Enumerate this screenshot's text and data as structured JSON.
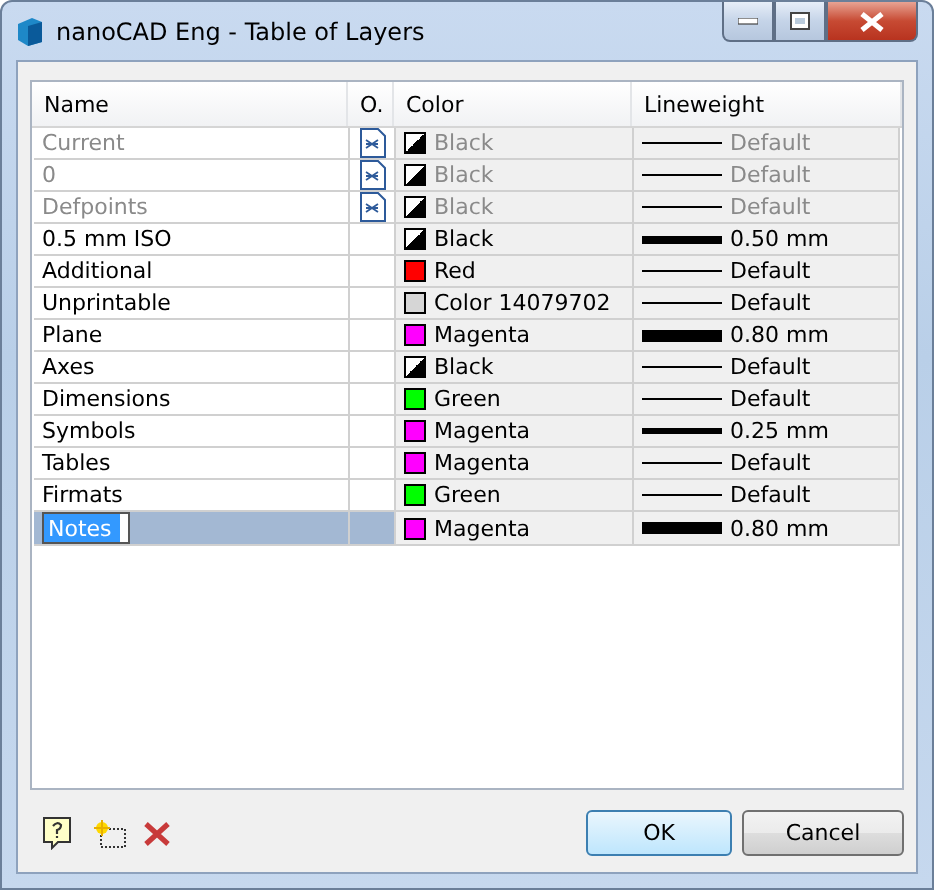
{
  "window": {
    "title": "nanoCAD Eng - Table of Layers"
  },
  "table": {
    "columns": [
      "Name",
      "O.",
      "Color",
      "Lineweight"
    ],
    "rows": [
      {
        "name": "Current",
        "dimmed": true,
        "owner_icon": true,
        "swatch": {
          "kind": "diagonal",
          "color": "#000000",
          "label": "Black"
        },
        "lineweight": {
          "kind": "thin",
          "label": "Default"
        },
        "selected": false,
        "editing": false
      },
      {
        "name": "0",
        "dimmed": true,
        "owner_icon": true,
        "swatch": {
          "kind": "diagonal",
          "color": "#000000",
          "label": "Black"
        },
        "lineweight": {
          "kind": "thin",
          "label": "Default"
        },
        "selected": false,
        "editing": false
      },
      {
        "name": "Defpoints",
        "dimmed": true,
        "owner_icon": true,
        "swatch": {
          "kind": "diagonal",
          "color": "#000000",
          "label": "Black"
        },
        "lineweight": {
          "kind": "thin",
          "label": "Default"
        },
        "selected": false,
        "editing": false
      },
      {
        "name": "0.5 mm ISO",
        "dimmed": false,
        "owner_icon": false,
        "swatch": {
          "kind": "diagonal",
          "color": "#000000",
          "label": "Black"
        },
        "lineweight": {
          "kind": "thick",
          "label": "0.50 mm"
        },
        "selected": false,
        "editing": false
      },
      {
        "name": "Additional",
        "dimmed": false,
        "owner_icon": false,
        "swatch": {
          "kind": "solid",
          "color": "#ff0000",
          "label": "Red"
        },
        "lineweight": {
          "kind": "thin",
          "label": "Default"
        },
        "selected": false,
        "editing": false
      },
      {
        "name": "Unprintable",
        "dimmed": false,
        "owner_icon": false,
        "swatch": {
          "kind": "solid",
          "color": "#d6d6d6",
          "label": "Color 14079702"
        },
        "lineweight": {
          "kind": "thin",
          "label": "Default"
        },
        "selected": false,
        "editing": false
      },
      {
        "name": "Plane",
        "dimmed": false,
        "owner_icon": false,
        "swatch": {
          "kind": "solid",
          "color": "#ff00ff",
          "label": "Magenta"
        },
        "lineweight": {
          "kind": "heavy",
          "label": "0.80 mm"
        },
        "selected": false,
        "editing": false
      },
      {
        "name": "Axes",
        "dimmed": false,
        "owner_icon": false,
        "swatch": {
          "kind": "diagonal",
          "color": "#000000",
          "label": "Black"
        },
        "lineweight": {
          "kind": "thin",
          "label": "Default"
        },
        "selected": false,
        "editing": false
      },
      {
        "name": "Dimensions",
        "dimmed": false,
        "owner_icon": false,
        "swatch": {
          "kind": "solid",
          "color": "#00ff00",
          "label": "Green"
        },
        "lineweight": {
          "kind": "thin",
          "label": "Default"
        },
        "selected": false,
        "editing": false
      },
      {
        "name": "Symbols",
        "dimmed": false,
        "owner_icon": false,
        "swatch": {
          "kind": "solid",
          "color": "#ff00ff",
          "label": "Magenta"
        },
        "lineweight": {
          "kind": "medium",
          "label": "0.25 mm"
        },
        "selected": false,
        "editing": false
      },
      {
        "name": "Tables",
        "dimmed": false,
        "owner_icon": false,
        "swatch": {
          "kind": "solid",
          "color": "#ff00ff",
          "label": "Magenta"
        },
        "lineweight": {
          "kind": "thin",
          "label": "Default"
        },
        "selected": false,
        "editing": false
      },
      {
        "name": "Firmats",
        "dimmed": false,
        "owner_icon": false,
        "swatch": {
          "kind": "solid",
          "color": "#00ff00",
          "label": "Green"
        },
        "lineweight": {
          "kind": "thin",
          "label": "Default"
        },
        "selected": false,
        "editing": false
      },
      {
        "name": "Notes",
        "dimmed": false,
        "owner_icon": false,
        "swatch": {
          "kind": "solid",
          "color": "#ff00ff",
          "label": "Magenta"
        },
        "lineweight": {
          "kind": "heavy",
          "label": "0.80 mm"
        },
        "selected": true,
        "editing": true
      }
    ]
  },
  "buttons": [
    {
      "label": "OK",
      "default": true
    },
    {
      "label": "Cancel",
      "default": false
    }
  ]
}
